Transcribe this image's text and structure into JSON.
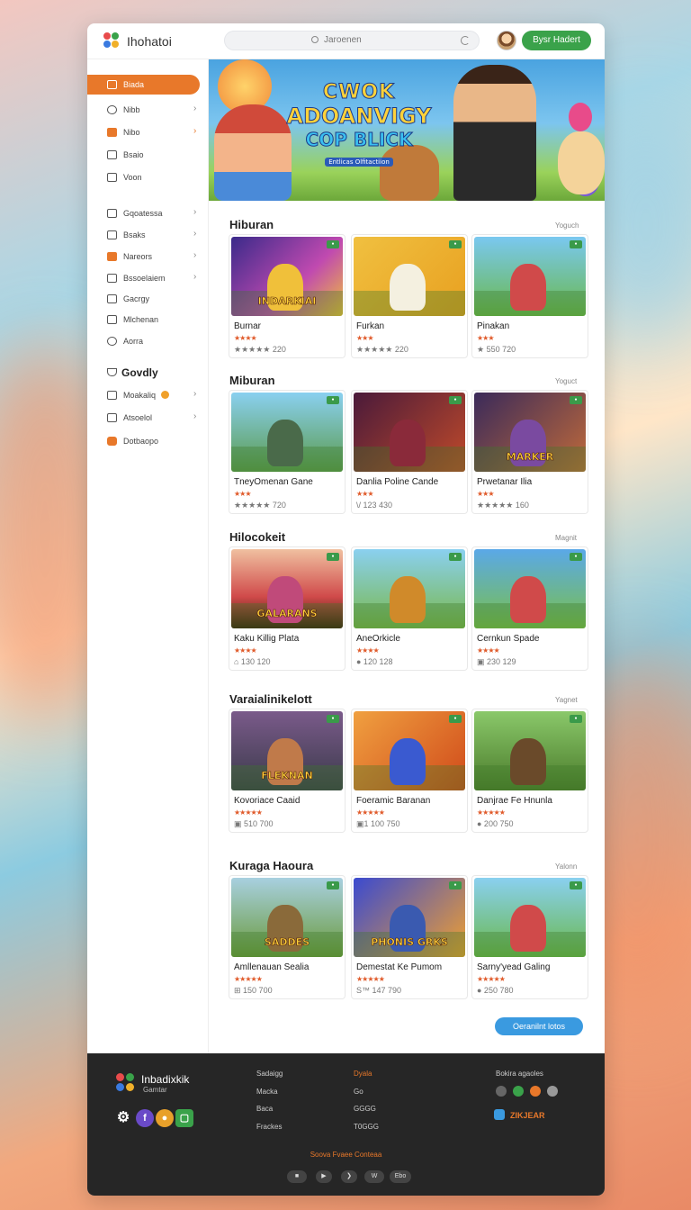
{
  "app": {
    "title": "Ihohatoi"
  },
  "search": {
    "placeholder": "Jaroenen"
  },
  "header": {
    "play_label": "Bysr Hadert"
  },
  "sidebar": {
    "items": [
      {
        "label": "Biada",
        "active": true
      },
      {
        "label": "Nibb",
        "chevron": true
      },
      {
        "label": "Nibo",
        "chevron": true
      },
      {
        "label": "Bsaio"
      },
      {
        "label": "Voon"
      }
    ],
    "group2": [
      {
        "label": "Gqoatessa",
        "chevron": true
      },
      {
        "label": "Bsaks",
        "chevron": true
      },
      {
        "label": "Nareors",
        "chevron": true
      },
      {
        "label": "Bssoelaiem",
        "chevron": true
      },
      {
        "label": "Gacrgy"
      },
      {
        "label": "Mlchenan"
      },
      {
        "label": "Aorra"
      }
    ],
    "heading": "Govdly",
    "group3": [
      {
        "label": "Moakaliq",
        "chevron": true
      },
      {
        "label": "Atsoelol",
        "chevron": true
      },
      {
        "label": "Dotbaopo"
      }
    ]
  },
  "hero": {
    "line1": "CWOK",
    "line2": "ADOANVIGY",
    "line3": "COP BLICK",
    "line4": "Entlicas Olfitactiion"
  },
  "sections": [
    {
      "title": "Hiburan",
      "link": "Yoguch",
      "cards": [
        {
          "name": "Burnar",
          "stars": "★★★★",
          "meta": "★★★★★ 220",
          "thumb_text": "INDARKIAI"
        },
        {
          "name": "Furkan",
          "stars": "★★★",
          "meta": "★★★★★ 220",
          "thumb_text": ""
        },
        {
          "name": "Pinakan",
          "stars": "★★★",
          "meta": "★ 550 720",
          "thumb_text": ""
        }
      ]
    },
    {
      "title": "Miburan",
      "link": "Yoguct",
      "cards": [
        {
          "name": "TneyOmenan Gane",
          "stars": "★★★",
          "meta": "★★★★★ 720",
          "thumb_text": ""
        },
        {
          "name": "Danlia Poline Cande",
          "stars": "★★★",
          "meta": "\\/ 123 430",
          "thumb_text": ""
        },
        {
          "name": "Prwetanar Ilia",
          "stars": "★★★",
          "meta": "★★★★★ 160",
          "thumb_text": "MARKER"
        }
      ]
    },
    {
      "title": "Hilocokeit",
      "link": "Magnit",
      "cards": [
        {
          "name": "Kaku Killig Plata",
          "stars": "★★★★",
          "meta": "⌂ 130 120",
          "thumb_text": "GALARANS"
        },
        {
          "name": "AneOrkicle",
          "stars": "★★★★",
          "meta": "● 120 128",
          "thumb_text": ""
        },
        {
          "name": "Cernkun Spade",
          "stars": "★★★★",
          "meta": "▣ 230 129",
          "thumb_text": ""
        }
      ]
    },
    {
      "title": "Varaialinikelott",
      "link": "Yagnet",
      "cards": [
        {
          "name": "Kovoriace Caaid",
          "stars": "★★★★★",
          "meta": "▣ 510 700",
          "thumb_text": "FLEKNAN"
        },
        {
          "name": "Foeramic Baranan",
          "stars": "★★★★★",
          "meta": "▣1 100 750",
          "thumb_text": ""
        },
        {
          "name": "Danjrae Fe Hnunla",
          "stars": "★★★★★",
          "meta": "● 200 750",
          "thumb_text": ""
        }
      ]
    },
    {
      "title": "Kuraga Haoura",
      "link": "Yalonn",
      "cards": [
        {
          "name": "Amllenauan Sealia",
          "stars": "★★★★★",
          "meta": "⊞ 150 700",
          "thumb_text": "SADDES"
        },
        {
          "name": "Demestat Ke Pumom",
          "stars": "★★★★★",
          "meta": "S™ 147 790",
          "thumb_text": "PHONIS GRKS"
        },
        {
          "name": "Sarny'yead Galing",
          "stars": "★★★★★",
          "meta": "● 250 780",
          "thumb_text": ""
        }
      ]
    }
  ],
  "more_button": "Oeranilnt lotos",
  "footer": {
    "brand": "Inbadixkik",
    "brand_sub": "Gamtar",
    "col1": [
      "Sadaigg",
      "Macka",
      "Baca",
      "Frackes"
    ],
    "col2": [
      "Dyala",
      "Go",
      "GGGG",
      "T0GGG"
    ],
    "col3_title": "Bokira agaoles",
    "badge_text": "ZIKJEAR",
    "copyright": "Soova Fvaee Conteaa",
    "controls": [
      "■",
      "▶",
      "❯",
      "W",
      "Ebo"
    ]
  },
  "colors": {
    "accent": "#e8782a",
    "green": "#3aa24a",
    "blue": "#3a9ae0",
    "footer_bg": "#262626"
  }
}
